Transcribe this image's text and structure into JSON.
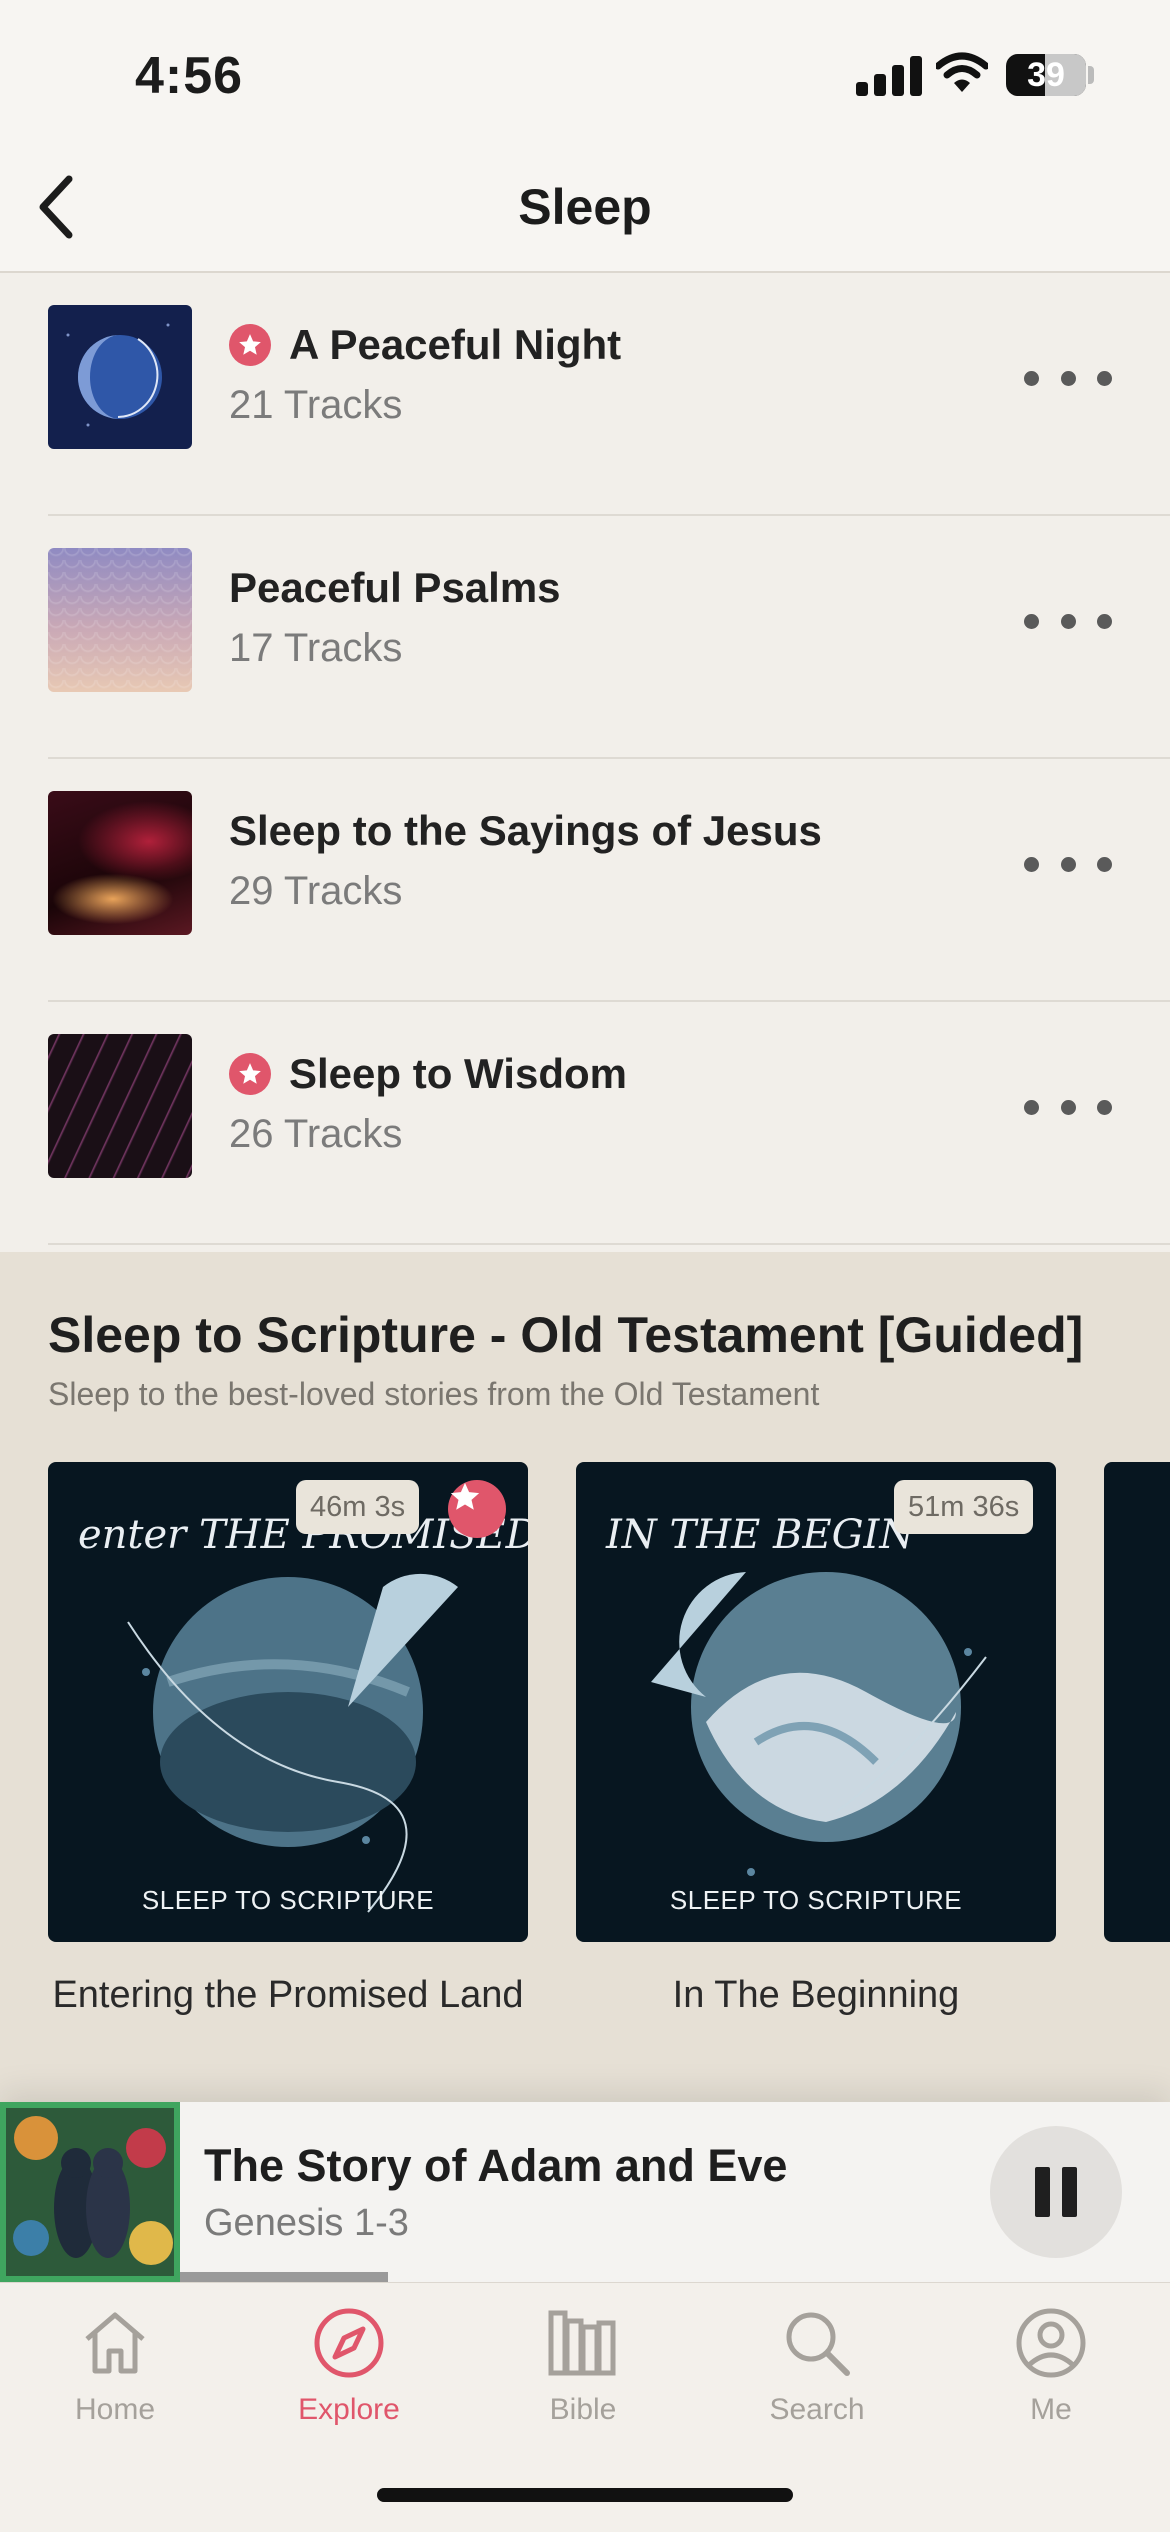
{
  "status_bar": {
    "time": "4:56",
    "battery": "39"
  },
  "header": {
    "title": "Sleep",
    "back_icon": "chevron-left-icon"
  },
  "playlists": [
    {
      "title": "A Peaceful Night",
      "subtitle": "21 Tracks",
      "featured": true
    },
    {
      "title": "Peaceful Psalms",
      "subtitle": "17 Tracks",
      "featured": false
    },
    {
      "title": "Sleep to the Sayings of Jesus",
      "subtitle": "29 Tracks",
      "featured": false
    },
    {
      "title": "Sleep to Wisdom",
      "subtitle": "26 Tracks",
      "featured": true
    }
  ],
  "guided_section": {
    "title": "Sleep to Scripture - Old Testament [Guided]",
    "subtitle": "Sleep to the best-loved stories from the Old Testament",
    "cards": [
      {
        "art_heading": "enter THE PROMISED LAND",
        "art_footer": "SLEEP TO SCRIPTURE",
        "duration": "46m 3s",
        "featured": true,
        "label": "Entering the Promised Land"
      },
      {
        "art_heading": "IN THE BEGIN",
        "art_footer": "SLEEP TO SCRIPTURE",
        "duration": "51m 36s",
        "featured": false,
        "label": "In The Beginning"
      }
    ]
  },
  "now_playing": {
    "title": "The Story of Adam and Eve",
    "subtitle": "Genesis 1-3",
    "progress": 0.21
  },
  "tabs": [
    {
      "label": "Home",
      "icon": "home-icon",
      "active": false
    },
    {
      "label": "Explore",
      "icon": "compass-icon",
      "active": true
    },
    {
      "label": "Bible",
      "icon": "bible-icon",
      "active": false
    },
    {
      "label": "Search",
      "icon": "search-icon",
      "active": false
    },
    {
      "label": "Me",
      "icon": "profile-icon",
      "active": false
    }
  ],
  "colors": {
    "accent": "#e0566b",
    "background": "#f2efea",
    "section_bg": "#e6e0d5",
    "player_accent": "#3fa55f"
  }
}
